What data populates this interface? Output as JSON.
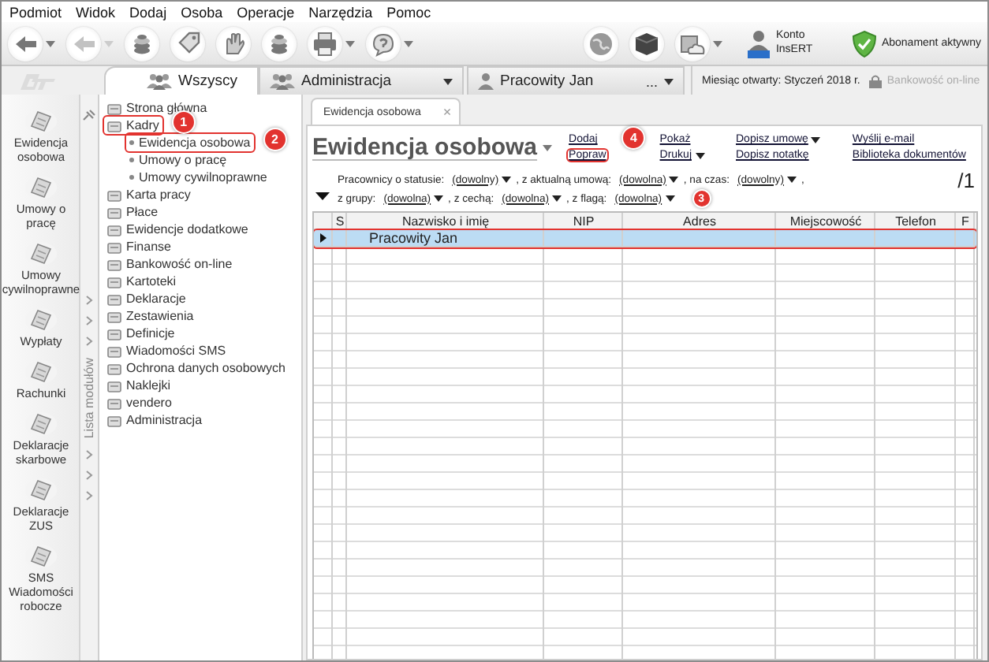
{
  "menu": [
    "Podmiot",
    "Widok",
    "Dodaj",
    "Osoba",
    "Operacje",
    "Narzędzia",
    "Pomoc"
  ],
  "toolbar": {
    "buttons": [
      {
        "kind": "arrow",
        "dropdown": true,
        "disabled": false
      },
      {
        "kind": "arrow",
        "dropdown": true,
        "disabled": true
      },
      {
        "kind": "coins",
        "dropdown": false,
        "disabled": false
      },
      {
        "kind": "tag",
        "dropdown": false,
        "disabled": false
      },
      {
        "kind": "hand",
        "dropdown": false,
        "disabled": false
      },
      {
        "kind": "coins",
        "dropdown": false,
        "disabled": false
      },
      {
        "kind": "printer",
        "dropdown": true,
        "disabled": false
      },
      {
        "kind": "help",
        "dropdown": true,
        "disabled": false
      }
    ],
    "account": "Konto InsERT",
    "subscription": "Abonament aktywny"
  },
  "tabs": [
    {
      "label": "Wszyscy",
      "kind": "group",
      "selected": true,
      "dropdown": false
    },
    {
      "label": "Administracja",
      "kind": "group",
      "selected": false,
      "dropdown": true
    },
    {
      "label": "Pracowity Jan",
      "kind": "person",
      "selected": false,
      "dropdown": true,
      "more": "..."
    }
  ],
  "status": {
    "month": "Miesiąc otwarty: Styczeń 2018 r.",
    "bank": "Bankowość on-line",
    "bank_disabled": true
  },
  "modules": [
    "Ewidencja osobowa",
    "Umowy o pracę",
    "Umowy cywilnoprawne",
    "Wypłaty",
    "Rachunki",
    "Deklaracje skarbowe",
    "Deklaracje ZUS",
    "SMS Wiadomości robocze"
  ],
  "modules_strip": "Lista modułów",
  "tree": [
    {
      "label": "Strona główna",
      "highlighted": false
    },
    {
      "label": "Kadry",
      "highlighted": true,
      "callout": "1",
      "children": [
        {
          "label": "Ewidencja osobowa",
          "highlighted": true,
          "callout": "2"
        },
        {
          "label": "Umowy o pracę",
          "highlighted": false
        },
        {
          "label": "Umowy cywilnoprawne",
          "highlighted": false
        }
      ]
    },
    {
      "label": "Karta pracy",
      "highlighted": false
    },
    {
      "label": "Płace",
      "highlighted": false
    },
    {
      "label": "Ewidencje dodatkowe",
      "highlighted": false
    },
    {
      "label": "Finanse",
      "highlighted": false
    },
    {
      "label": "Bankowość on-line",
      "highlighted": false
    },
    {
      "label": "Kartoteki",
      "highlighted": false
    },
    {
      "label": "Deklaracje",
      "highlighted": false
    },
    {
      "label": "Zestawienia",
      "highlighted": false
    },
    {
      "label": "Definicje",
      "highlighted": false
    },
    {
      "label": "Wiadomości SMS",
      "highlighted": false
    },
    {
      "label": "Ochrona danych osobowych",
      "highlighted": false
    },
    {
      "label": "Naklejki",
      "highlighted": false
    },
    {
      "label": "vendero",
      "highlighted": false
    },
    {
      "label": "Administracja",
      "highlighted": false
    }
  ],
  "document": {
    "tab": "Ewidencja osobowa",
    "close": "×",
    "title": "Ewidencja osobowa",
    "actions": [
      [
        {
          "label": "Dodaj",
          "dropdown": false,
          "highlighted": false
        },
        {
          "label": "Popraw",
          "dropdown": false,
          "highlighted": true,
          "callout": "4"
        }
      ],
      [
        {
          "label": "Pokaż",
          "dropdown": false,
          "highlighted": false
        },
        {
          "label": "Drukuj",
          "dropdown": true,
          "highlighted": false
        }
      ],
      [
        {
          "label": "Dopisz umowę",
          "dropdown": true,
          "highlighted": false
        },
        {
          "label": "Dopisz notatkę",
          "dropdown": false,
          "highlighted": false
        }
      ],
      [
        {
          "label": "Wyślij e-mail",
          "dropdown": false,
          "highlighted": false
        },
        {
          "label": "Biblioteka dokumentów",
          "dropdown": false,
          "highlighted": false
        }
      ]
    ],
    "filters": [
      {
        "parts": [
          {
            "label": "Pracownicy o statusie:",
            "value": "(dowolny)"
          },
          {
            "label": ", z aktualną umową:",
            "value": "(dowolna)"
          },
          {
            "label": ", na czas:",
            "value": "(dowolny)"
          }
        ],
        "end": ","
      },
      {
        "parts": [
          {
            "label": "z grupy:",
            "value": "(dowolna)"
          },
          {
            "label": ", z cechą:",
            "value": "(dowolna)"
          },
          {
            "label": ", z flagą:",
            "value": "(dowolna)"
          }
        ]
      }
    ],
    "count": "/1",
    "table": {
      "columns": [
        "S",
        "Nazwisko i imię",
        "NIP",
        "Adres",
        "Miejscowość",
        "Telefon",
        "F"
      ],
      "rows": [
        {
          "name": "Pracowity Jan",
          "selected": true,
          "highlighted": true,
          "callout": "3"
        }
      ]
    }
  }
}
